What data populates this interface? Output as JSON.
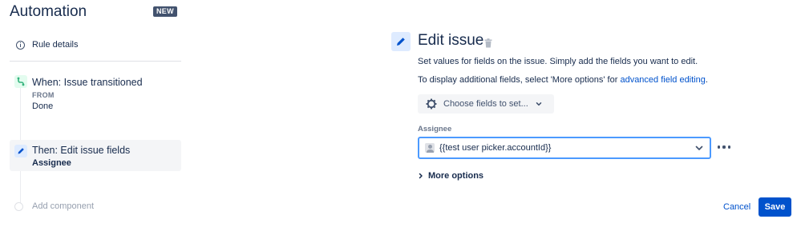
{
  "app": {
    "title": "Automation",
    "badge": "NEW"
  },
  "sidebar": {
    "rule_details": {
      "label": "Rule details",
      "icon": "info-icon"
    },
    "trigger": {
      "icon": "transition-icon",
      "title": "When: Issue transitioned",
      "from_label": "FROM",
      "from_value": "Done"
    },
    "action": {
      "icon": "pencil-icon",
      "title": "Then: Edit issue fields",
      "subtitle": "Assignee"
    },
    "add_component": {
      "label": "Add component"
    }
  },
  "editor": {
    "title": "Edit issue",
    "description": "Set values for fields on the issue. Simply add the fields you want to edit.",
    "additional_prefix": "To display additional fields, select 'More options' for ",
    "additional_link": "advanced field editing",
    "additional_suffix": ".",
    "choose_fields_label": "Choose fields to set...",
    "assignee_label": "Assignee",
    "assignee_value": "{{test user picker.accountId}}",
    "more_options_label": "More options"
  },
  "footer": {
    "cancel_label": "Cancel",
    "save_label": "Save"
  },
  "colors": {
    "accent": "#0052cc",
    "focus": "#4c9aff",
    "trigger_bg": "#e3fcef",
    "action_bg": "#deebff"
  }
}
